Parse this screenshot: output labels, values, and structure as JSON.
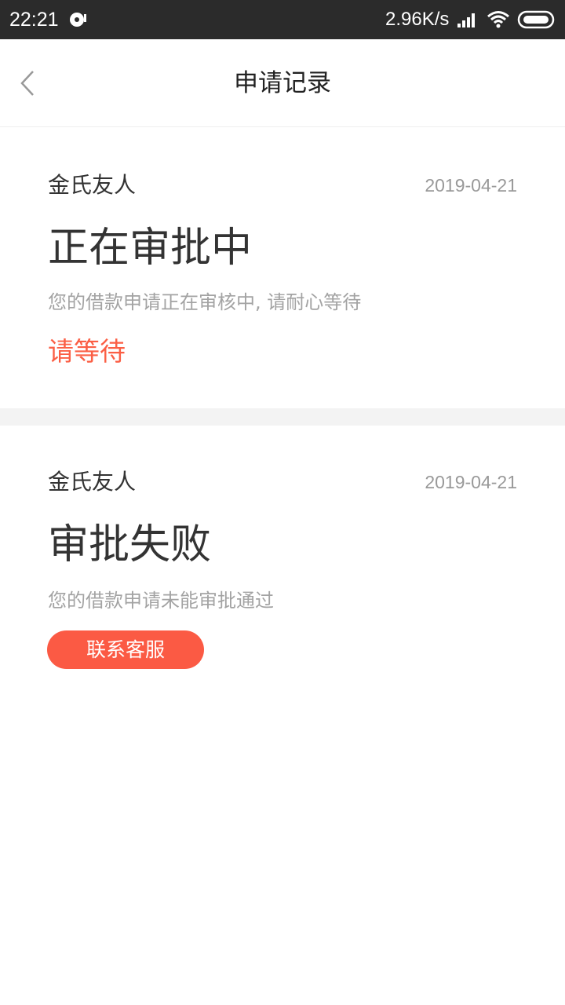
{
  "status_bar": {
    "time": "22:21",
    "net_speed": "2.96K/s",
    "icons": [
      "media-app-icon",
      "signal-icon",
      "wifi-icon",
      "battery-icon"
    ]
  },
  "nav": {
    "back_icon": "chevron-left-icon",
    "title": "申请记录"
  },
  "records": [
    {
      "lender": "金氏友人",
      "date": "2019-04-21",
      "status": "正在审批中",
      "description": "您的借款申请正在审核中, 请耐心等待",
      "action_label": "请等待"
    },
    {
      "lender": "金氏友人",
      "date": "2019-04-21",
      "status": "审批失败",
      "description": "您的借款申请未能审批通过",
      "action_label": "联系客服"
    }
  ],
  "colors": {
    "accent": "#fb5a44",
    "status_bar_bg": "#2b2b2b",
    "separator": "#f3f3f3"
  }
}
